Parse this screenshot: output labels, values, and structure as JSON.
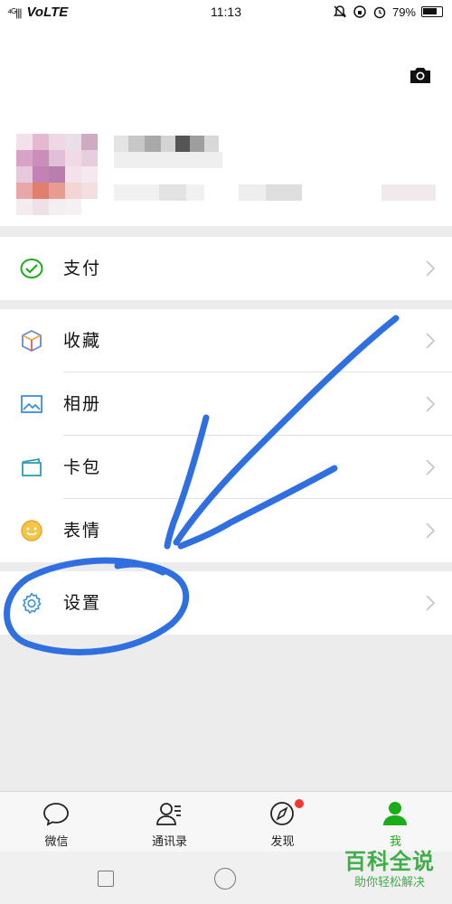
{
  "status_bar": {
    "signal": "⁴ᴳ|||",
    "network": "VoLTE",
    "time": "11:13",
    "battery": "79%"
  },
  "menu": {
    "pay": "支付",
    "favorites": "收藏",
    "album": "相册",
    "cards": "卡包",
    "stickers": "表情",
    "settings": "设置"
  },
  "tabs": [
    {
      "label": "微信",
      "icon": "chat-bubble-icon"
    },
    {
      "label": "通讯录",
      "icon": "contacts-icon"
    },
    {
      "label": "发现",
      "icon": "compass-icon"
    },
    {
      "label": "我",
      "icon": "person-icon",
      "active": true
    }
  ],
  "watermark": {
    "title": "百科全说",
    "subtitle": "助你轻松解决"
  },
  "colors": {
    "accent_green": "#1aad19",
    "annotation_blue": "#2f6fe0",
    "badge_red": "#f43530"
  }
}
